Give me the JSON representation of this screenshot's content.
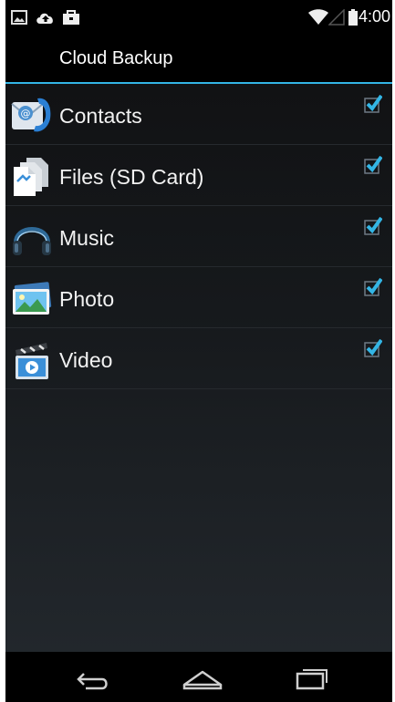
{
  "status_bar": {
    "time": "4:00",
    "left_icons": [
      "picture-icon",
      "cloud-upload-icon",
      "briefcase-icon"
    ],
    "right_icons": [
      "wifi-icon",
      "signal-icon",
      "battery-icon"
    ]
  },
  "action_bar": {
    "title": "Cloud Backup"
  },
  "items": [
    {
      "label": "Contacts",
      "icon": "contacts-icon",
      "checked": true
    },
    {
      "label": "Files (SD Card)",
      "icon": "files-icon",
      "checked": true
    },
    {
      "label": "Music",
      "icon": "headphones-icon",
      "checked": true
    },
    {
      "label": "Photo",
      "icon": "photo-icon",
      "checked": true
    },
    {
      "label": "Video",
      "icon": "video-icon",
      "checked": true
    }
  ],
  "nav_bar": {
    "buttons": [
      "back-icon",
      "home-icon",
      "recent-apps-icon"
    ]
  },
  "colors": {
    "accent": "#33b5e5",
    "background": "#000000",
    "text": "#ffffff"
  }
}
